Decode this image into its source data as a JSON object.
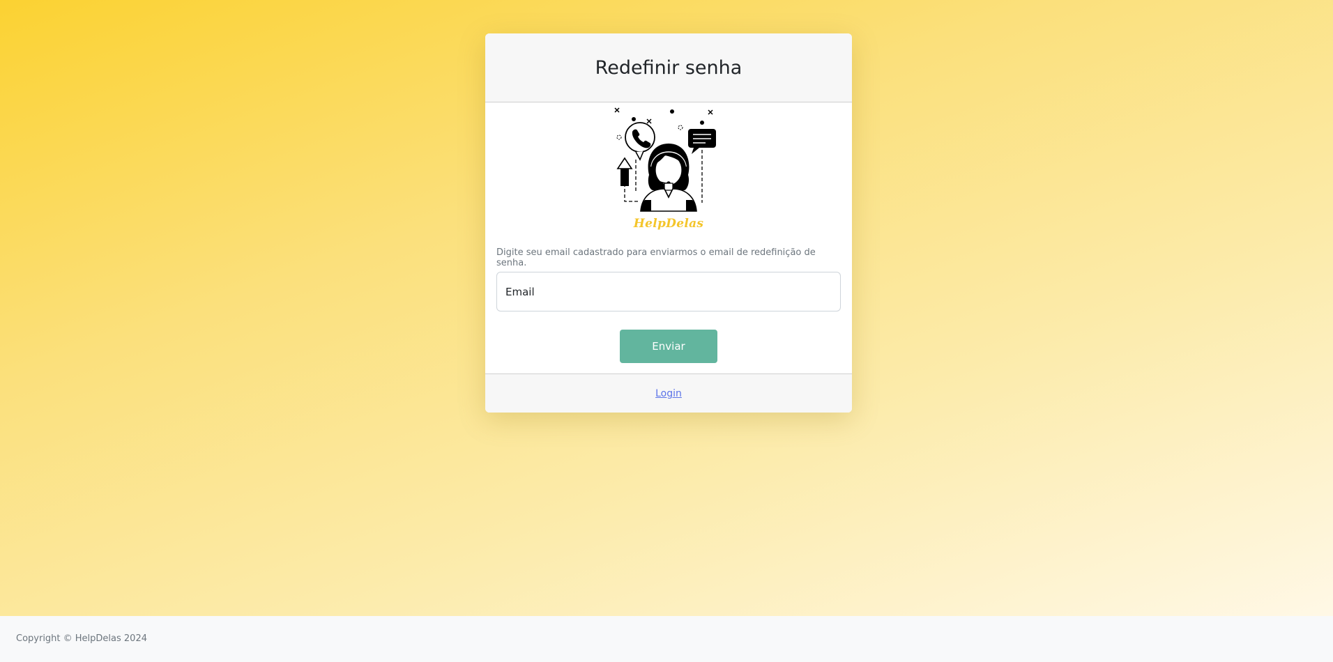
{
  "card": {
    "title": "Redefinir senha",
    "brand_name": "HelpDelas",
    "illustration_icon": "support-agent-headset-icon",
    "instructions": "Digite seu email cadastrado para enviarmos o email de redefinição de senha.",
    "email": {
      "placeholder": "Email",
      "value": ""
    },
    "submit_label": "Enviar",
    "login_link_label": "Login"
  },
  "footer": {
    "copyright": "Copyright © HelpDelas 2024"
  },
  "colors": {
    "background_gradient_start": "#fbd232",
    "background_gradient_end": "#fff8e6",
    "button": "#62b59e",
    "brand": "#f4c52b",
    "link": "#5b73e8"
  }
}
